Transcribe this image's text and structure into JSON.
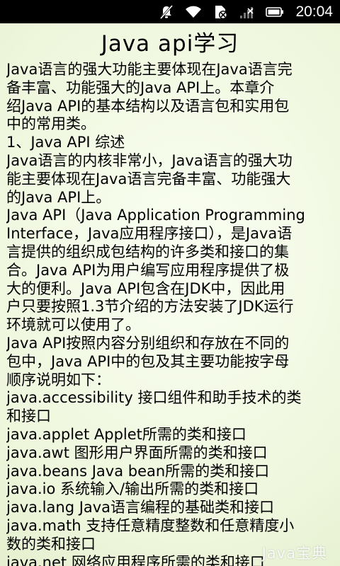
{
  "status_bar": {
    "icons": [
      "mute-icon",
      "wifi-icon",
      "no-sim-icon",
      "signal-icon",
      "battery-icon"
    ],
    "time": "20:04"
  },
  "page": {
    "title": "Java api学习"
  },
  "article": {
    "lines": [
      "Java语言的强大功能主要体现在Java语言完",
      "备丰富、功能强大的Java API上。本章介",
      "绍Java API的基本结构以及语言包和实用包",
      "中的常用类。",
      "1、Java API 综述",
      "Java语言的内核非常小，Java语言的强大功",
      "能主要体现在Java语言完备丰富、功能强大",
      "的Java API上。",
      "Java API（Java Application Programming",
      "Interface，Java应用程序接口），是Java语",
      "言提供的组织成包结构的许多类和接口的集",
      "合。Java API为用户编写应用程序提供了极",
      "大的便利。Java API包含在JDK中，因此用",
      "户只要按照1.3节介绍的方法安装了JDK运行",
      "环境就可以使用了。",
      "Java API按照内容分别组织和存放在不同的",
      "包中，Java API中的包及其主要功能按字母",
      "顺序说明如下：",
      "java.accessibility 接口组件和助手技术的类",
      "和接口",
      "java.applet Applet所需的类和接口",
      "java.awt 图形用户界面所需的类和接口",
      "java.beans Java bean所需的类和接口",
      "java.io 系统输入/输出所需的类和接口",
      "java.lang Java语言编程的基础类和接口",
      "java.math 支持任意精度整数和任意精度小",
      "数的类和接口",
      "java.net 网络应用程序所需的类和接口"
    ]
  },
  "watermark": "Java宝典"
}
